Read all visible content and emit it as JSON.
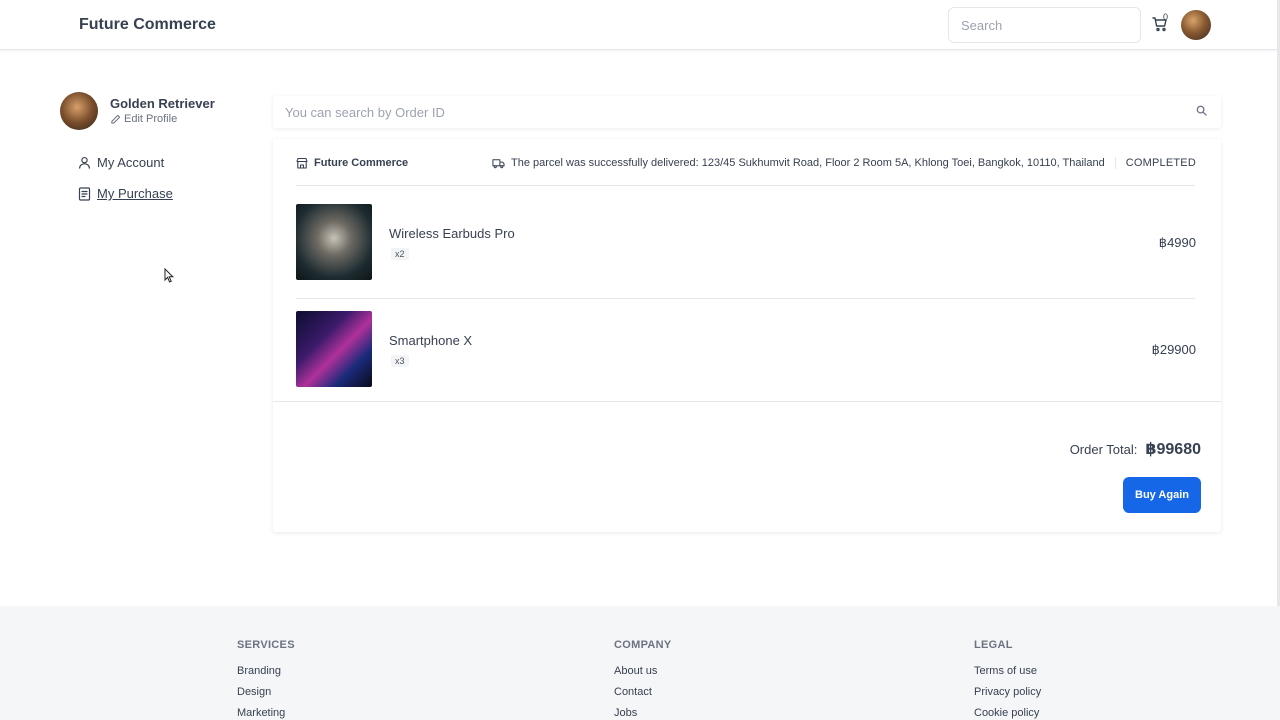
{
  "header": {
    "brand": "Future Commerce",
    "search_placeholder": "Search",
    "cart_count": "0"
  },
  "sidebar": {
    "profile_name": "Golden Retriever",
    "edit_profile": "Edit Profile",
    "items": [
      {
        "label": "My Account",
        "icon": "user-icon"
      },
      {
        "label": "My Purchase",
        "icon": "receipt-icon",
        "active": true
      }
    ]
  },
  "order_search": {
    "placeholder": "You can search by Order ID"
  },
  "order": {
    "shop_name": "Future Commerce",
    "delivery_message": "The parcel was successfully delivered: 123/45 Sukhumvit Road, Floor 2 Room 5A, Khlong Toei, Bangkok, 10110, Thailand",
    "status": "COMPLETED",
    "items": [
      {
        "name": "Wireless Earbuds Pro",
        "qty": "x2",
        "price": "฿4990"
      },
      {
        "name": "Smartphone X",
        "qty": "x3",
        "price": "฿29900"
      }
    ],
    "total_label": "Order Total:",
    "total_value": "฿99680",
    "buy_again_label": "Buy Again"
  },
  "footer": {
    "services": {
      "title": "SERVICES",
      "links": [
        "Branding",
        "Design",
        "Marketing"
      ]
    },
    "company": {
      "title": "COMPANY",
      "links": [
        "About us",
        "Contact",
        "Jobs"
      ]
    },
    "legal": {
      "title": "LEGAL",
      "links": [
        "Terms of use",
        "Privacy policy",
        "Cookie policy"
      ]
    }
  },
  "colors": {
    "accent": "#1667e8",
    "text": "#374151",
    "muted": "#9ca3af"
  }
}
